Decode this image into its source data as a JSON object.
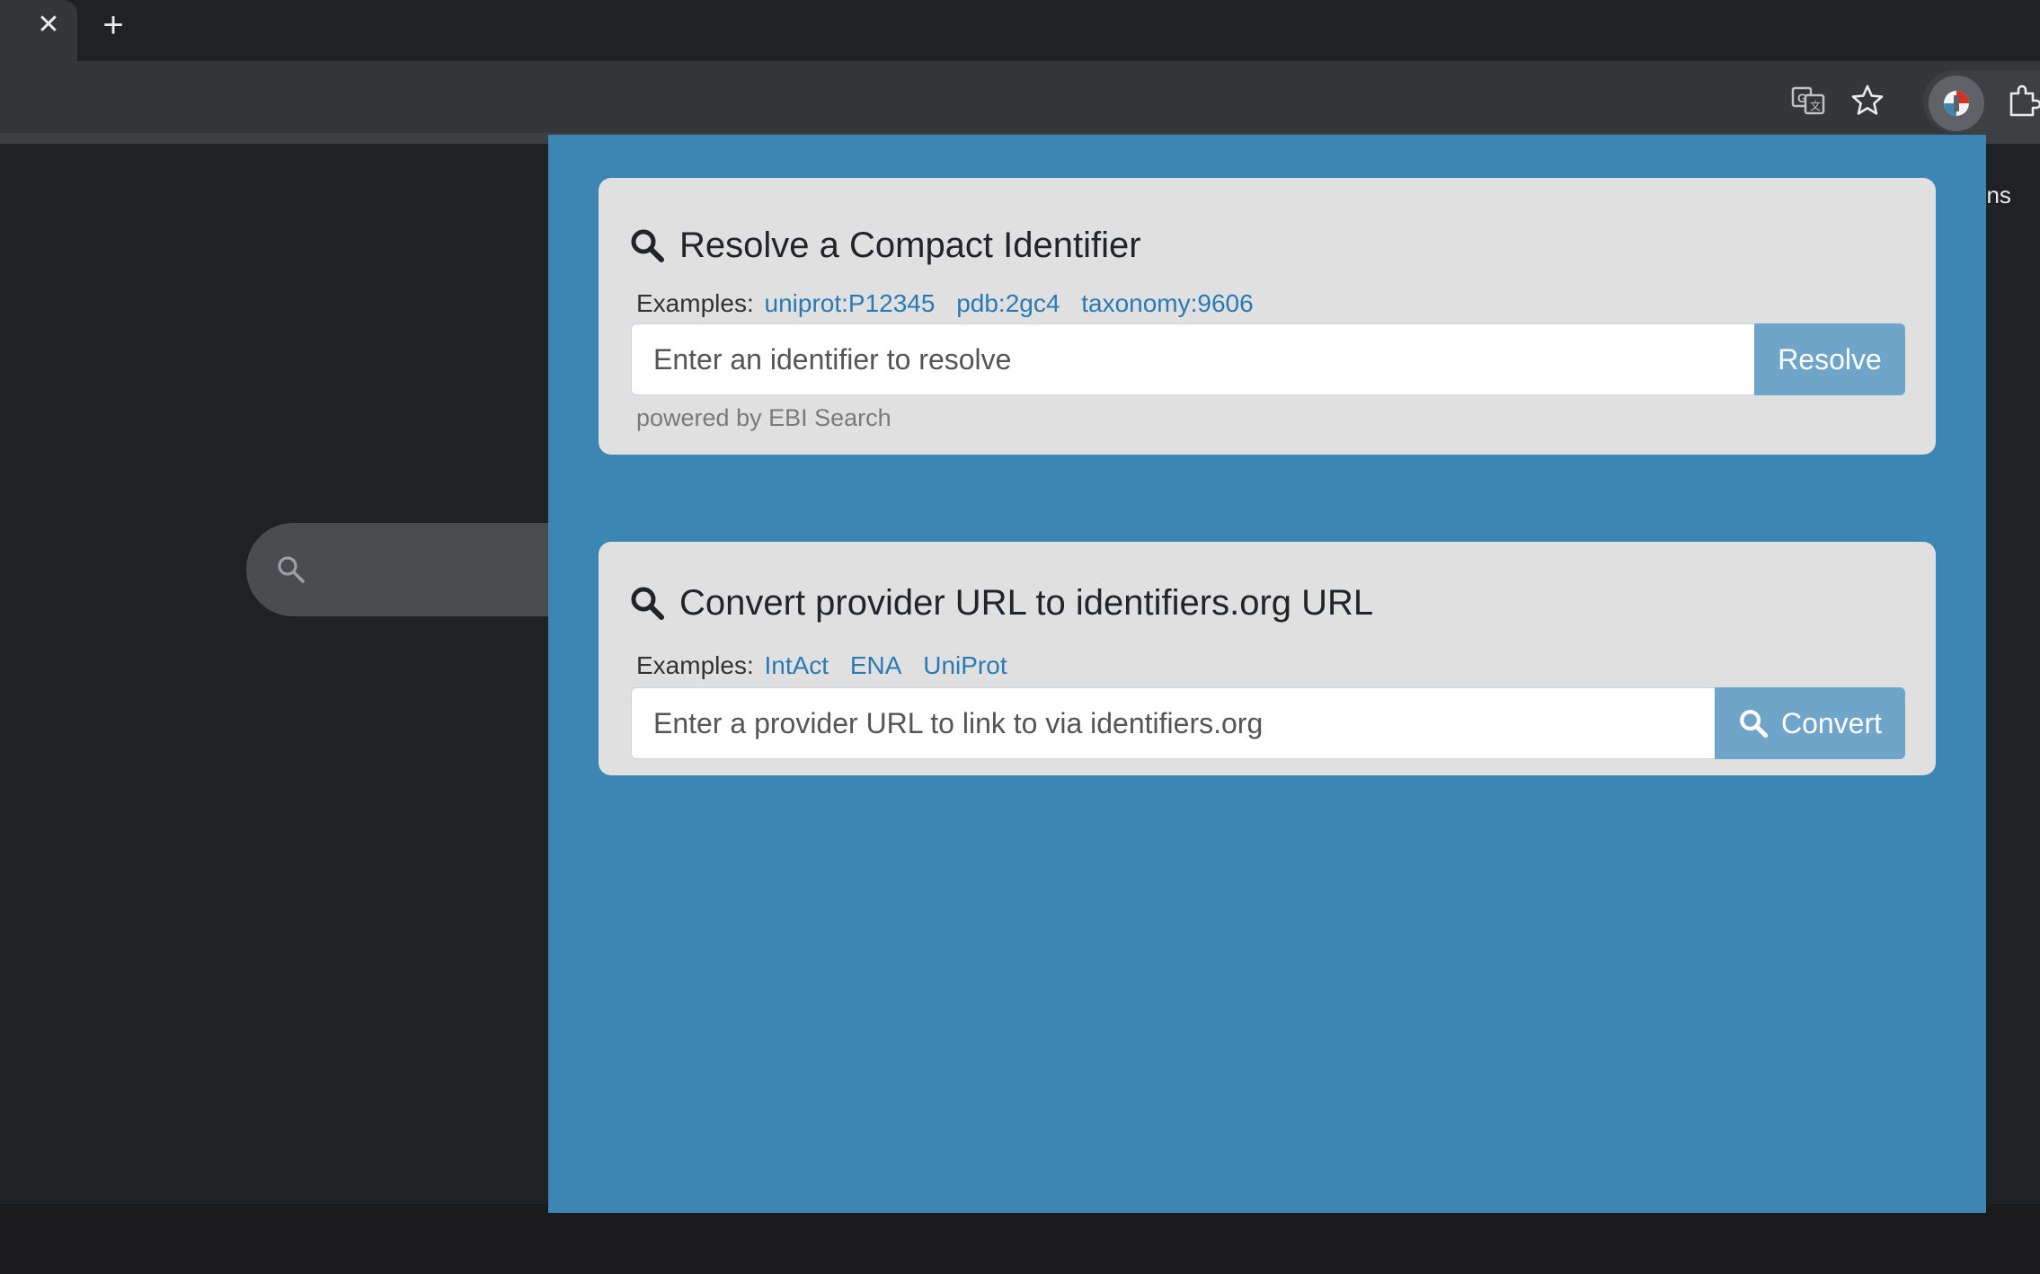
{
  "browser": {
    "tab_close_glyph": "✕",
    "new_tab_glyph": "+",
    "toolbar_icons": [
      "translate-icon",
      "bookmark-star-icon",
      "profile-avatar-icon",
      "extensions-icon"
    ]
  },
  "background_page": {
    "partial_link_text": "ens",
    "search_icon": "search-icon"
  },
  "popup": {
    "background_color": "#3b86b2",
    "resolve": {
      "title": "Resolve a Compact Identifier",
      "examples_label": "Examples:",
      "examples": [
        "uniprot:P12345",
        "pdb:2gc4",
        "taxonomy:9606"
      ],
      "input_placeholder": "Enter an identifier to resolve",
      "button_label": "Resolve",
      "footer": "powered by EBI Search"
    },
    "convert": {
      "title": "Convert provider URL to identifiers.org URL",
      "examples_label": "Examples:",
      "examples": [
        "IntAct",
        "ENA",
        "UniProt"
      ],
      "input_placeholder": "Enter a provider URL to link to via identifiers.org",
      "button_label": "Convert"
    },
    "colors": {
      "link": "#2a7ab5",
      "button": "#6fa5c8",
      "card": "#e0e0e0"
    }
  }
}
